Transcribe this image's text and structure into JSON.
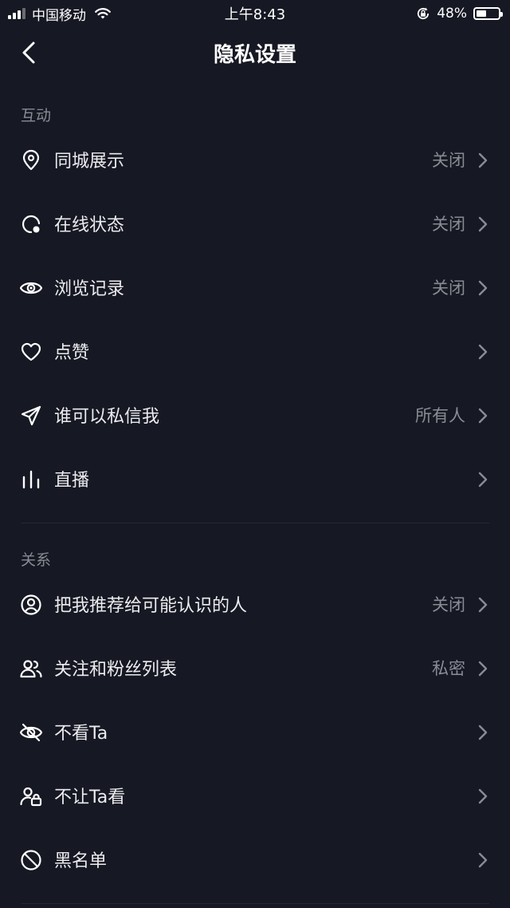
{
  "status_bar": {
    "carrier": "中国移动",
    "time": "上午8:43",
    "battery_percent": "48%",
    "battery_level": 0.48
  },
  "nav": {
    "title": "隐私设置",
    "back_icon": "chevron-left-icon"
  },
  "sections": [
    {
      "header": "互动",
      "items": [
        {
          "label": "同城展示",
          "value": "关闭",
          "icon": "location-pin-icon"
        },
        {
          "label": "在线状态",
          "value": "关闭",
          "icon": "online-status-icon"
        },
        {
          "label": "浏览记录",
          "value": "关闭",
          "icon": "eye-icon"
        },
        {
          "label": "点赞",
          "value": "",
          "icon": "heart-icon"
        },
        {
          "label": "谁可以私信我",
          "value": "所有人",
          "icon": "paper-plane-icon"
        },
        {
          "label": "直播",
          "value": "",
          "icon": "bars-icon"
        }
      ]
    },
    {
      "header": "关系",
      "items": [
        {
          "label": "把我推荐给可能认识的人",
          "value": "关闭",
          "icon": "user-circle-icon"
        },
        {
          "label": "关注和粉丝列表",
          "value": "私密",
          "icon": "users-icon"
        },
        {
          "label": "不看Ta",
          "value": "",
          "icon": "eye-off-icon"
        },
        {
          "label": "不让Ta看",
          "value": "",
          "icon": "user-lock-icon"
        },
        {
          "label": "黑名单",
          "value": "",
          "icon": "block-icon"
        }
      ]
    }
  ],
  "colors": {
    "background": "#161823",
    "text": "#ececef",
    "secondary_text": "#8a8b93"
  }
}
